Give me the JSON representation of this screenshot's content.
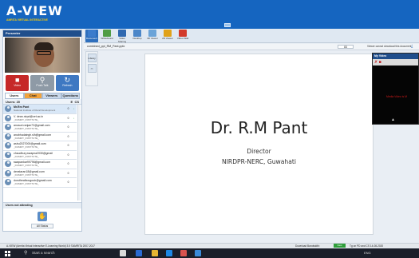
{
  "header": {
    "logo": "A-VIEW",
    "tagline": "AMRITA VIRTUAL INTERACTIVE"
  },
  "presenter": {
    "title": "Presenter"
  },
  "controls": [
    {
      "label": "Video",
      "icon": "video-icon",
      "color": "#c62828"
    },
    {
      "label": "Push Talk",
      "icon": "microphone-icon",
      "color": "#8e9aa6"
    },
    {
      "label": "Refresh",
      "icon": "refresh-icon",
      "color": "#3e78c2"
    }
  ],
  "panel_tabs": [
    {
      "label": "Users",
      "active": true
    },
    {
      "label": "Chat",
      "active": false
    },
    {
      "label": "Viewers",
      "active": false
    },
    {
      "label": "Questions",
      "active": false
    }
  ],
  "users_header": {
    "label": "Users: 20",
    "col1": "E",
    "col2": "CS"
  },
  "users": [
    {
      "name": "Mr.Rm Pant",
      "org": "National Institute of Rural Development",
      "c1": "0",
      "c2": "↓"
    },
    {
      "name": "V. dean.nirpd@cet.ac.in",
      "org": "_DUMMY_INSTITUTE_",
      "c1": "0",
      "c2": "↓"
    },
    {
      "name": "anusuri.ranjan72@gmail.com",
      "org": "_DUMMY_INSTITUTE_",
      "c1": "0",
      "c2": ""
    },
    {
      "name": "anubhudaingh.slh@gmail.com",
      "org": "_DUMMY_INSTITUTE_",
      "c1": "0",
      "c2": ""
    },
    {
      "name": "ashu2027000@gmail.com",
      "org": "_DUMMY_INSTITUTE_",
      "c1": "0",
      "c2": ""
    },
    {
      "name": "chaudhury.swapna2030@gmail",
      "org": "_DUMMY_INSTITUTE_",
      "c1": "0",
      "c2": ""
    },
    {
      "name": "swapankar99796@gmail.com",
      "org": "_DUMMY_INSTITUTE_",
      "c1": "0",
      "c2": ""
    },
    {
      "name": "devstaran18@gmail.com",
      "org": "_DUMMY_INSTITUTE_",
      "c1": "0",
      "c2": ""
    },
    {
      "name": "dorothealbougouh@gmail.com",
      "org": "_DUMMY_INSTITUTE_",
      "c1": "0",
      "c2": ""
    }
  ],
  "users_not_attending": "Users not attending",
  "all_status": "All Status",
  "toolbar": [
    {
      "label": "Document",
      "color": "#3c7ccc",
      "active": true
    },
    {
      "label": "Whiteboard",
      "color": "#4f9c45"
    },
    {
      "label": "Video Sharing",
      "color": "#2f68b0"
    },
    {
      "label": "Desktop",
      "color": "#4b86c8"
    },
    {
      "label": "3D Viewer",
      "color": "#6aa3d8"
    },
    {
      "label": "2D Viewer",
      "color": "#e0a21a"
    },
    {
      "label": "Video Wall",
      "color": "#d23a2a"
    }
  ],
  "docbar": {
    "filename": "combined_ppt_RM_Pant.pptx",
    "page": "83",
    "note": "Viewer cannot download this document"
  },
  "side_tools": [
    "Library"
  ],
  "slide": {
    "title": "Dr. R.M Pant",
    "line1": "Director",
    "line2": "NIRDPR-NERC, Guwahati"
  },
  "my_video": {
    "title": "My Video",
    "text": "Media Video is M"
  },
  "statusbar": {
    "left": "A-VIEW (Amrita Virtual Interactive E-Learning World) 3.5 ©AMRITA 2007-2017",
    "bandwidth_label": "Download Bandwidth:",
    "bandwidth_badge": "Fast",
    "right": "Tg on PD and CS 14-08-2020"
  },
  "taskbar": {
    "search_placeholder": "Start a search",
    "tray": "ENG"
  }
}
